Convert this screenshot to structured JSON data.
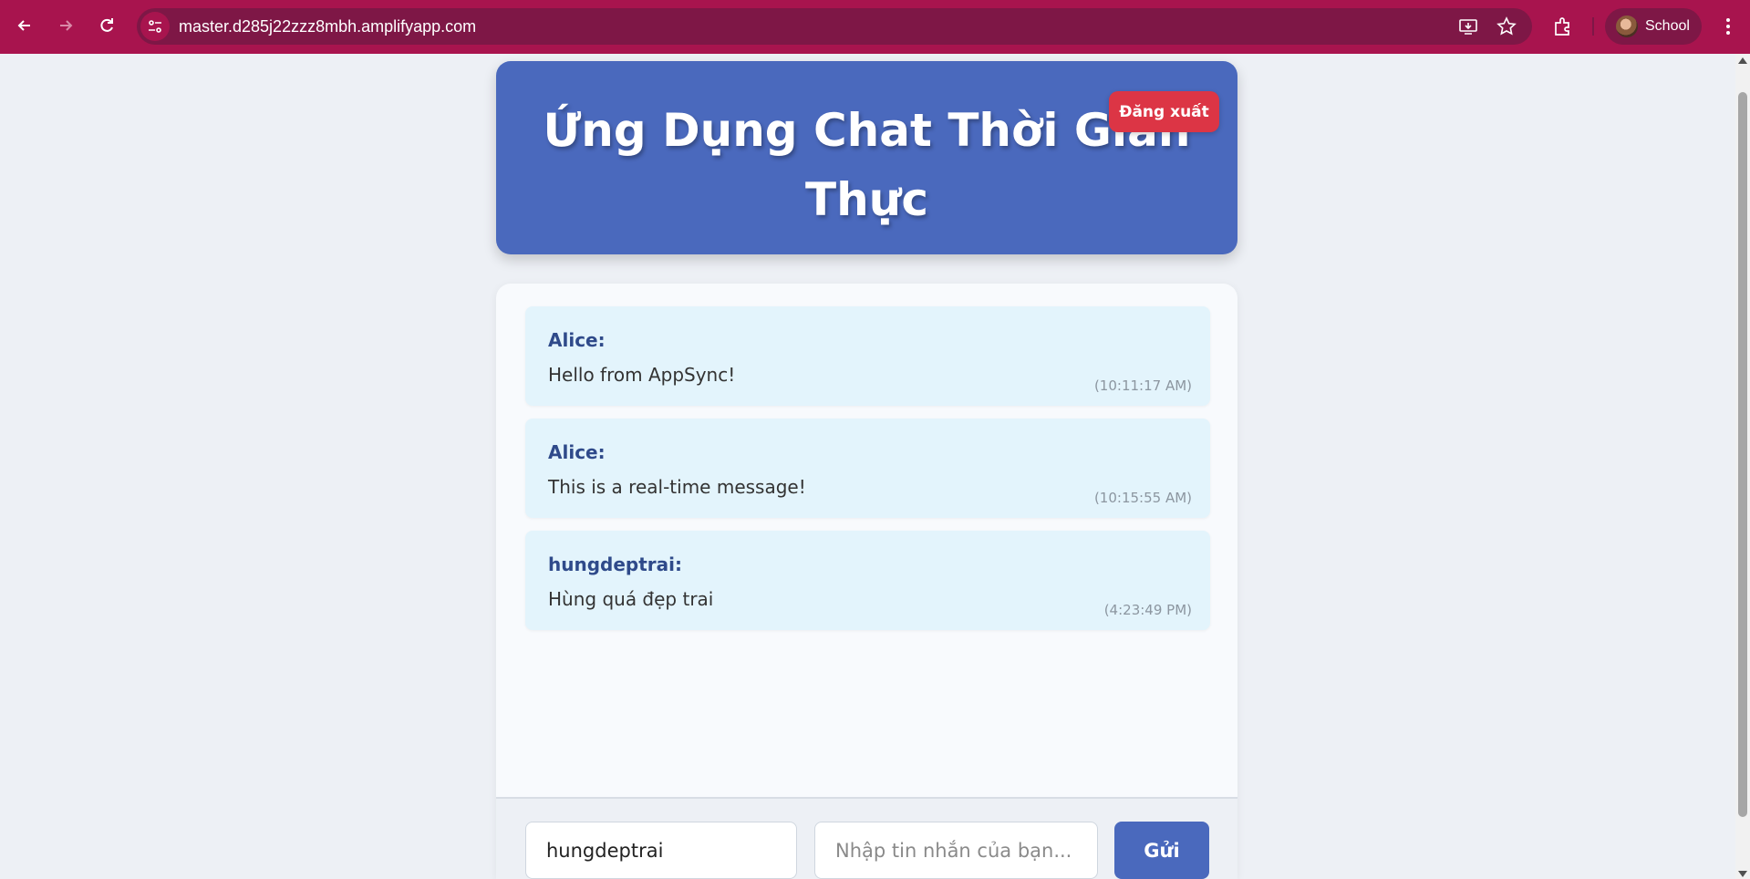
{
  "browser": {
    "url": "master.d285j22zzz8mbh.amplifyapp.com",
    "profile_label": "School",
    "icons": [
      "back-icon",
      "forward-icon",
      "reload-icon",
      "site-info-icon",
      "install-icon",
      "star-icon",
      "extensions-icon",
      "menu-icon"
    ]
  },
  "header": {
    "title": "Ứng Dụng Chat Thời Gian Thực",
    "logout_label": "Đăng xuất"
  },
  "messages": [
    {
      "user": "Alice:",
      "text": "Hello from AppSync!",
      "time": "(10:11:17 AM)"
    },
    {
      "user": "Alice:",
      "text": "This is a real-time message!",
      "time": "(10:15:55 AM)"
    },
    {
      "user": "hungdeptrai:",
      "text": "Hùng quá đẹp trai",
      "time": "(4:23:49 PM)"
    }
  ],
  "composer": {
    "username_value": "hungdeptrai",
    "message_placeholder": "Nhập tin nhắn của bạn...",
    "send_label": "Gửi"
  },
  "colors": {
    "chrome": "#a8144e",
    "header": "#4a69bd",
    "logout": "#dc3545",
    "message_bg": "#e3f4fc",
    "username": "#2f4a8a"
  }
}
